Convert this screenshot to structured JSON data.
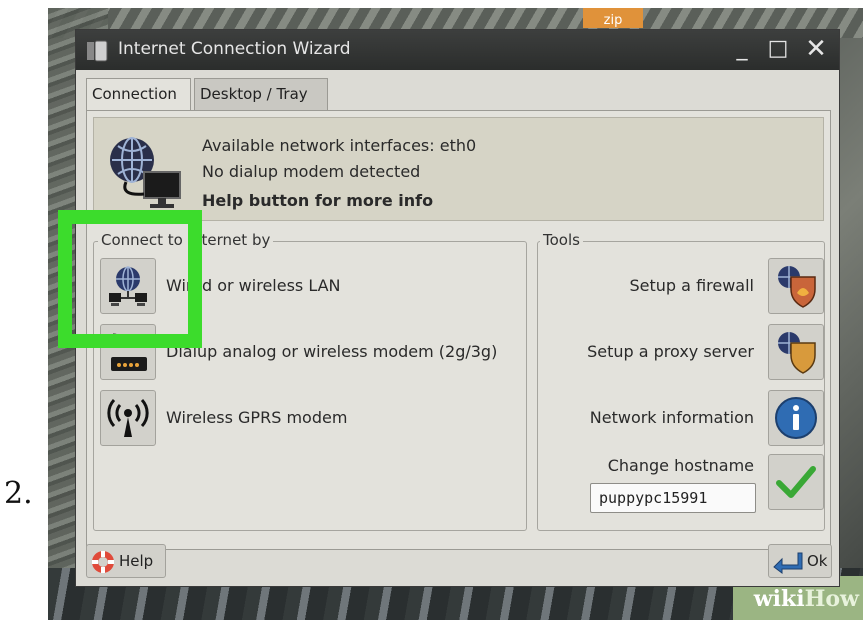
{
  "step_number": "2.",
  "desktop": {
    "badge": "zip"
  },
  "watermark": {
    "part1": "wiki",
    "part2": "How"
  },
  "window": {
    "title": "Internet Connection Wizard",
    "controls": {
      "minimize": "_",
      "maximize": "□",
      "close": "✕"
    }
  },
  "tabs": [
    {
      "label": "Connection",
      "active": true
    },
    {
      "label": "Desktop / Tray",
      "active": false
    }
  ],
  "info": {
    "line1": "Available network interfaces: eth0",
    "line2": "No dialup modem detected",
    "line3": "Help button for more info"
  },
  "connect_group": {
    "legend": "Connect to Internet by",
    "options": [
      {
        "label": "Wired or wireless LAN",
        "icon": "network-globe-icon"
      },
      {
        "label": "Dialup analog or wireless modem (2g/3g)",
        "icon": "modem-icon"
      },
      {
        "label": "Wireless GPRS modem",
        "icon": "antenna-icon"
      }
    ]
  },
  "tools_group": {
    "legend": "Tools",
    "items": [
      {
        "label": "Setup a firewall",
        "icon": "firewall-shield-icon"
      },
      {
        "label": "Setup a proxy server",
        "icon": "proxy-shield-icon"
      },
      {
        "label": "Network information",
        "icon": "info-icon"
      }
    ],
    "hostname": {
      "label": "Change hostname",
      "value": "puppypc15991",
      "icon": "checkmark-icon"
    }
  },
  "buttons": {
    "help": "Help",
    "ok": "Ok"
  },
  "colors": {
    "highlight": "#3cdc2c",
    "titlebar": "#2b2d2c",
    "window_bg": "#dcdbd5"
  }
}
